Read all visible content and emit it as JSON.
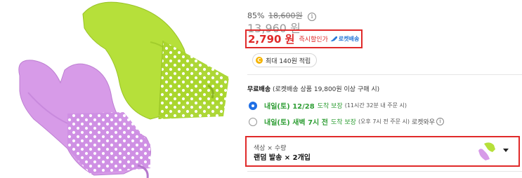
{
  "pricing": {
    "discount_percent": "85%",
    "original_price": "18,600원",
    "info_icon": "info-circle-icon",
    "before_coupon_price": "13,960 원",
    "sale_price": "2,790 원",
    "sale_note": "즉시할인가",
    "rocket_label": "로켓배송",
    "rocket_icon": "rocket-icon",
    "rocket_color": "#2a7ad8",
    "sale_color": "#e02a2a"
  },
  "points": {
    "icon": "coin-icon",
    "icon_glyph": "C",
    "label": "최대 140원 적립"
  },
  "shipping": {
    "title": "무료배송",
    "condition": " (로켓배송 상품 19,800원 이상 구매 시)"
  },
  "delivery_options": [
    {
      "selected": true,
      "day": "내일(토) 12/28",
      "guarantee": "도착 보장",
      "detail": "(11시간 32분 내 주문 시)",
      "extra": ""
    },
    {
      "selected": false,
      "day": "내일(토) 새벽 7시 전",
      "guarantee": "도착 보장",
      "detail": "(오후 7시 전 주문 시)",
      "extra": "로켓와우"
    }
  ],
  "option_selector": {
    "label": "색상 × 수량",
    "value": "랜덤 발송 × 2개입",
    "thumb_icon": "oven-mitt-thumbnail",
    "caret_icon": "caret-down-icon"
  },
  "colors": {
    "green_accent": "#2f9e35",
    "radio_selected": "#1f6fe5",
    "mitt_lime": "#b6e03a",
    "mitt_violet": "#d79be8"
  }
}
